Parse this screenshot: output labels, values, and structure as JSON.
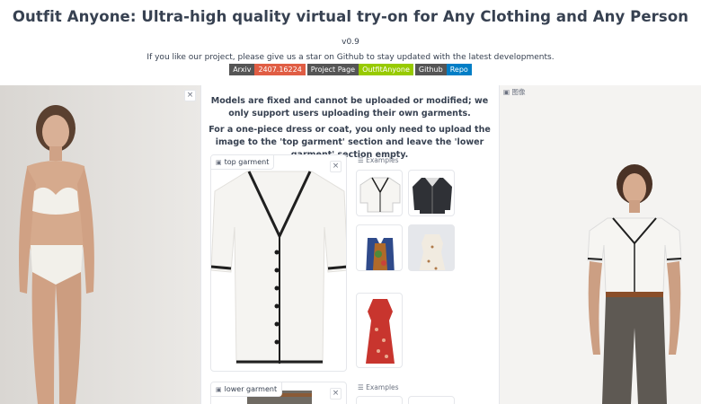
{
  "header": {
    "title": "Outfit Anyone: Ultra-high quality virtual try-on for Any Clothing and Any Person",
    "version": "v0.9",
    "star_message": "If you like our project, please give us a star on Github to stay updated with the latest developments."
  },
  "badges": [
    {
      "left": "Arxiv",
      "right": "2407.16224"
    },
    {
      "left": "Project Page",
      "right": "OutfitAnyone"
    },
    {
      "left": "Github",
      "right": "Repo"
    }
  ],
  "notice": {
    "line1": "Models are fixed and cannot be uploaded or modified; we only support users uploading their own garments.",
    "line2": "For a one-piece dress or coat, you only need to upload the image to the 'top garment' section and leave the 'lower garment' section empty."
  },
  "top_garment": {
    "label": "top garment",
    "examples_label": "Examples"
  },
  "lower_garment": {
    "label": "lower garment",
    "examples_label": "Examples"
  },
  "output": {
    "label": "图像"
  },
  "icons": {
    "close": "×"
  }
}
